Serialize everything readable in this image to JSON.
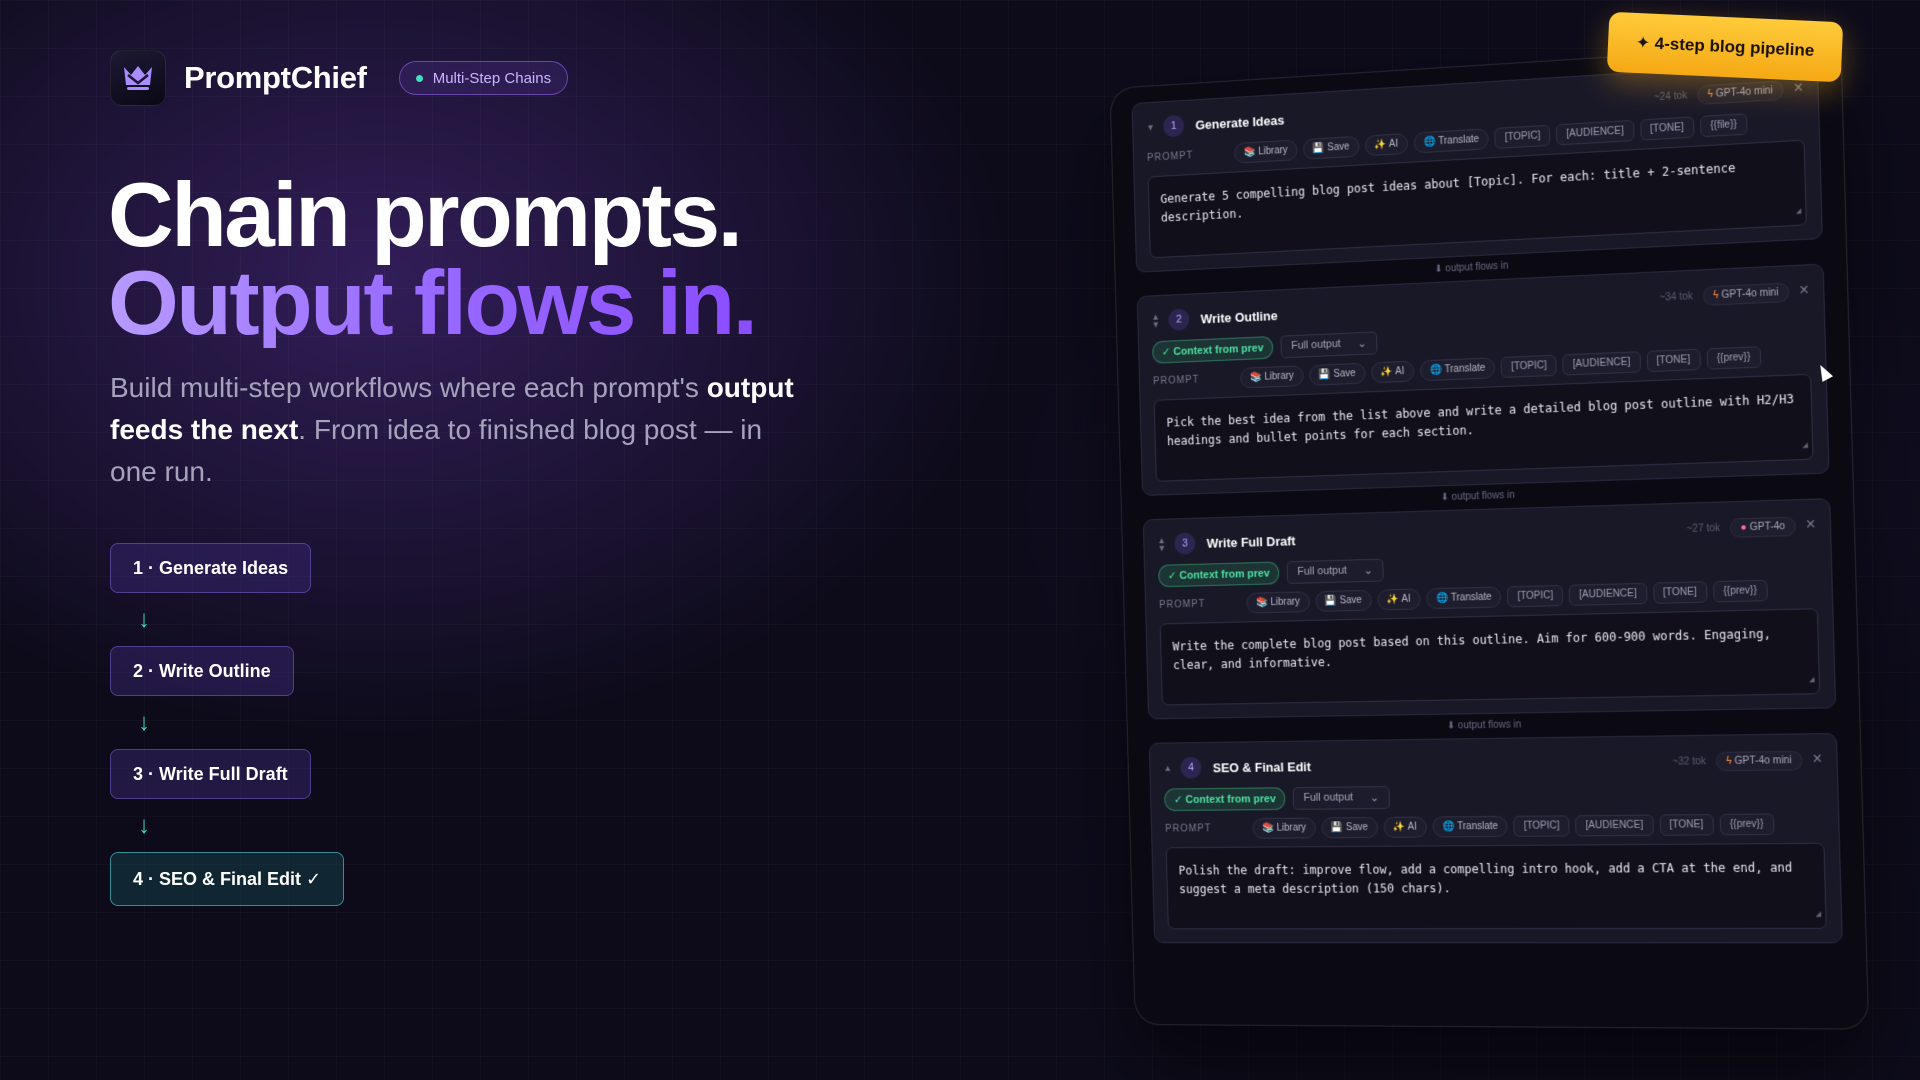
{
  "brand": {
    "name": "PromptChief",
    "tag": "Multi-Step Chains"
  },
  "hero": {
    "line1": "Chain prompts.",
    "line2": "Output flows in.",
    "sub_a": "Build multi-step workflows where each prompt's ",
    "sub_bold": "output feeds the next",
    "sub_b": ". From idea to finished blog post — in one run."
  },
  "steps": [
    {
      "label": "1 · Generate Ideas"
    },
    {
      "label": "2 · Write Outline"
    },
    {
      "label": "3 · Write Full Draft"
    },
    {
      "label": "4 · SEO & Final Edit ✓"
    }
  ],
  "step_arrow": "↓",
  "badge": "✦ 4-step blog pipeline",
  "editor": {
    "prompt_label": "PROMPT",
    "context_label": "✓ Context from prev",
    "context_mode": "Full output",
    "flow_label": "⬇ output flows in",
    "tools": {
      "library": "Library",
      "save": "Save",
      "ai": "AI",
      "translate": "Translate"
    },
    "cards": [
      {
        "number": "1",
        "title": "Generate Ideas",
        "tokens": "~24 tok",
        "model": "GPT-4o mini",
        "tags": [
          "[TOPIC]",
          "[AUDIENCE]",
          "[TONE]",
          "{{file}}"
        ],
        "prompt": "Generate 5 compelling blog post ideas about [Topic]. For each: title + 2-sentence description."
      },
      {
        "number": "2",
        "title": "Write Outline",
        "tokens": "~34 tok",
        "model": "GPT-4o mini",
        "tags": [
          "[TOPIC]",
          "[AUDIENCE]",
          "[TONE]",
          "{{prev}}"
        ],
        "prompt": "Pick the best idea from the list above and write a detailed blog post outline with H2/H3 headings and bullet points for each section."
      },
      {
        "number": "3",
        "title": "Write Full Draft",
        "tokens": "~27 tok",
        "model": "GPT-4o",
        "tags": [
          "[TOPIC]",
          "[AUDIENCE]",
          "[TONE]",
          "{{prev}}"
        ],
        "prompt": "Write the complete blog post based on this outline. Aim for 600-900 words. Engaging, clear, and informative."
      },
      {
        "number": "4",
        "title": "SEO & Final Edit",
        "tokens": "~32 tok",
        "model": "GPT-4o mini",
        "tags": [
          "[TOPIC]",
          "[AUDIENCE]",
          "[TONE]",
          "{{prev}}"
        ],
        "prompt": "Polish the draft: improve flow, add a compelling intro hook, add a CTA at the end, and suggest a meta description (150 chars)."
      }
    ]
  },
  "colors": {
    "accent": "#9a6cff",
    "teal": "#35d8c2",
    "badge": "#ffcb3a",
    "bg": "#0d0b1a"
  }
}
